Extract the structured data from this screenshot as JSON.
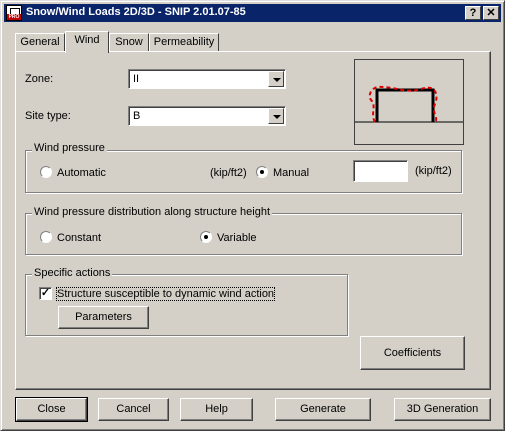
{
  "window": {
    "title": "Snow/Wind Loads 2D/3D - SNIP 2.01.07-85",
    "icon": "pro-app-icon"
  },
  "titlebar_buttons": {
    "help": "?",
    "close": "✕"
  },
  "tabs": [
    {
      "label": "General",
      "active": false
    },
    {
      "label": "Wind",
      "active": true
    },
    {
      "label": "Snow",
      "active": false
    },
    {
      "label": "Permeability",
      "active": false
    }
  ],
  "zone": {
    "label": "Zone:",
    "value": "II"
  },
  "site_type": {
    "label": "Site type:",
    "value": "B"
  },
  "wind_pressure": {
    "title": "Wind pressure",
    "automatic_label": "Automatic",
    "unit_auto": "(kip/ft2)",
    "manual_label": "Manual",
    "manual_value": "",
    "unit_manual": "(kip/ft2)",
    "selected": "manual"
  },
  "distribution": {
    "title": "Wind pressure distribution along structure height",
    "constant_label": "Constant",
    "variable_label": "Variable",
    "selected": "variable"
  },
  "specific_actions": {
    "title": "Specific actions",
    "checkbox_label": "Structure susceptible to dynamic wind action",
    "checked": true,
    "parameters_label": "Parameters"
  },
  "coefficients_label": "Coefficients",
  "footer": {
    "close": "Close",
    "cancel": "Cancel",
    "help": "Help",
    "generate": "Generate",
    "generation_3d": "3D Generation"
  },
  "colors": {
    "titlebar": "#0a246a",
    "face": "#d4d0c8",
    "preview_load": "#e00000"
  }
}
